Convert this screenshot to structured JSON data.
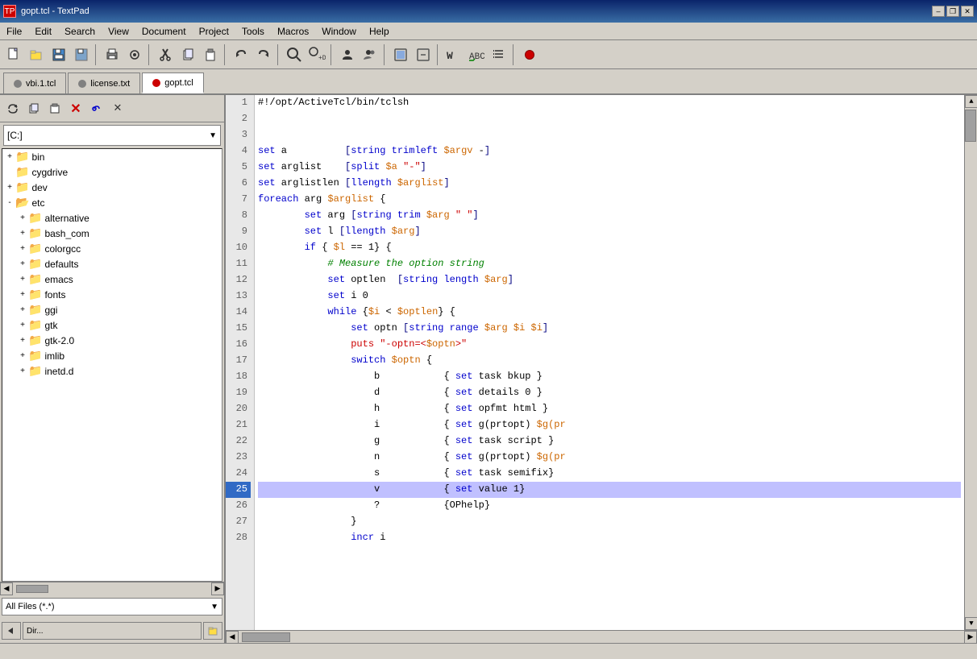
{
  "titlebar": {
    "title": "gopt.tcl - TextPad",
    "icon": "TP",
    "min": "–",
    "max": "❐",
    "close": "✕"
  },
  "menubar": {
    "items": [
      "File",
      "Edit",
      "Search",
      "View",
      "Document",
      "Project",
      "Tools",
      "Macros",
      "Window",
      "Help"
    ]
  },
  "tabs": [
    {
      "id": "vbi",
      "label": "vbi.1.tcl",
      "dot": "gray",
      "active": false
    },
    {
      "id": "license",
      "label": "license.txt",
      "dot": "gray",
      "active": false
    },
    {
      "id": "gopt",
      "label": "gopt.tcl",
      "dot": "red",
      "active": true
    }
  ],
  "sidebar": {
    "drive": "[C:]",
    "filter": "All Files (*.*)",
    "tree": [
      {
        "indent": 0,
        "toggle": "+",
        "name": "bin",
        "level": 1
      },
      {
        "indent": 0,
        "toggle": "",
        "name": "cygdrive",
        "level": 1
      },
      {
        "indent": 0,
        "toggle": "+",
        "name": "dev",
        "level": 1
      },
      {
        "indent": 0,
        "toggle": "-",
        "name": "etc",
        "level": 1
      },
      {
        "indent": 1,
        "toggle": "+",
        "name": "alternative",
        "level": 2
      },
      {
        "indent": 1,
        "toggle": "+",
        "name": "bash_com",
        "level": 2
      },
      {
        "indent": 1,
        "toggle": "+",
        "name": "colorgcc",
        "level": 2
      },
      {
        "indent": 1,
        "toggle": "+",
        "name": "defaults",
        "level": 2
      },
      {
        "indent": 1,
        "toggle": "+",
        "name": "emacs",
        "level": 2
      },
      {
        "indent": 1,
        "toggle": "+",
        "name": "fonts",
        "level": 2
      },
      {
        "indent": 1,
        "toggle": "+",
        "name": "ggi",
        "level": 2
      },
      {
        "indent": 1,
        "toggle": "+",
        "name": "gtk",
        "level": 2
      },
      {
        "indent": 1,
        "toggle": "+",
        "name": "gtk-2.0",
        "level": 2
      },
      {
        "indent": 1,
        "toggle": "+",
        "name": "imlib",
        "level": 2
      },
      {
        "indent": 1,
        "toggle": "+",
        "name": "inetd.d",
        "level": 2
      }
    ]
  },
  "code": {
    "shebang": "#!/opt/ActiveTcl/bin/tclsh",
    "lines": [
      {
        "num": 1,
        "tokens": [
          {
            "t": "plain",
            "v": "#!/opt/ActiveTcl/bin/tclsh"
          }
        ]
      },
      {
        "num": 2,
        "tokens": []
      },
      {
        "num": 3,
        "tokens": []
      },
      {
        "num": 4,
        "tokens": [
          {
            "t": "kw",
            "v": "set"
          },
          {
            "t": "plain",
            "v": " a          "
          },
          {
            "t": "bracket",
            "v": "["
          },
          {
            "t": "kw",
            "v": "string trimleft"
          },
          {
            "t": "plain",
            "v": " "
          },
          {
            "t": "var",
            "v": "$argv"
          },
          {
            "t": "plain",
            "v": " -"
          },
          {
            "t": "bracket",
            "v": "]"
          }
        ]
      },
      {
        "num": 5,
        "tokens": [
          {
            "t": "kw",
            "v": "set"
          },
          {
            "t": "plain",
            "v": " arglist    "
          },
          {
            "t": "bracket",
            "v": "["
          },
          {
            "t": "kw",
            "v": "split"
          },
          {
            "t": "plain",
            "v": " "
          },
          {
            "t": "var",
            "v": "$a"
          },
          {
            "t": "plain",
            "v": " "
          },
          {
            "t": "str",
            "v": "\"-\""
          },
          {
            "t": "bracket",
            "v": "]"
          }
        ]
      },
      {
        "num": 6,
        "tokens": [
          {
            "t": "kw",
            "v": "set"
          },
          {
            "t": "plain",
            "v": " arglistlen "
          },
          {
            "t": "bracket",
            "v": "["
          },
          {
            "t": "kw",
            "v": "llength"
          },
          {
            "t": "plain",
            "v": " "
          },
          {
            "t": "var",
            "v": "$arglist"
          },
          {
            "t": "bracket",
            "v": "]"
          }
        ]
      },
      {
        "num": 7,
        "tokens": [
          {
            "t": "kw",
            "v": "foreach"
          },
          {
            "t": "plain",
            "v": " arg "
          },
          {
            "t": "var",
            "v": "$arglist"
          },
          {
            "t": "plain",
            "v": " {"
          }
        ]
      },
      {
        "num": 8,
        "tokens": [
          {
            "t": "plain",
            "v": "        "
          },
          {
            "t": "kw",
            "v": "set"
          },
          {
            "t": "plain",
            "v": " arg "
          },
          {
            "t": "bracket",
            "v": "["
          },
          {
            "t": "kw",
            "v": "string trim"
          },
          {
            "t": "plain",
            "v": " "
          },
          {
            "t": "var",
            "v": "$arg"
          },
          {
            "t": "plain",
            "v": " "
          },
          {
            "t": "str",
            "v": "\" \""
          },
          {
            "t": "bracket",
            "v": "]"
          }
        ]
      },
      {
        "num": 9,
        "tokens": [
          {
            "t": "plain",
            "v": "        "
          },
          {
            "t": "kw",
            "v": "set"
          },
          {
            "t": "plain",
            "v": " l "
          },
          {
            "t": "bracket",
            "v": "["
          },
          {
            "t": "kw",
            "v": "llength"
          },
          {
            "t": "plain",
            "v": " "
          },
          {
            "t": "var",
            "v": "$arg"
          },
          {
            "t": "bracket",
            "v": "]"
          }
        ]
      },
      {
        "num": 10,
        "tokens": [
          {
            "t": "plain",
            "v": "        "
          },
          {
            "t": "kw",
            "v": "if"
          },
          {
            "t": "plain",
            "v": " { "
          },
          {
            "t": "var",
            "v": "$l"
          },
          {
            "t": "plain",
            "v": " == 1} {"
          }
        ]
      },
      {
        "num": 11,
        "tokens": [
          {
            "t": "plain",
            "v": "            "
          },
          {
            "t": "comment",
            "v": "# Measure the option string"
          }
        ]
      },
      {
        "num": 12,
        "tokens": [
          {
            "t": "plain",
            "v": "            "
          },
          {
            "t": "kw",
            "v": "set"
          },
          {
            "t": "plain",
            "v": " optlen  "
          },
          {
            "t": "bracket",
            "v": "["
          },
          {
            "t": "kw",
            "v": "string length"
          },
          {
            "t": "plain",
            "v": " "
          },
          {
            "t": "var",
            "v": "$arg"
          },
          {
            "t": "bracket",
            "v": "]"
          }
        ]
      },
      {
        "num": 13,
        "tokens": [
          {
            "t": "plain",
            "v": "            "
          },
          {
            "t": "kw",
            "v": "set"
          },
          {
            "t": "plain",
            "v": " i 0"
          }
        ]
      },
      {
        "num": 14,
        "tokens": [
          {
            "t": "plain",
            "v": "            "
          },
          {
            "t": "kw",
            "v": "while"
          },
          {
            "t": "plain",
            "v": " {"
          },
          {
            "t": "var",
            "v": "$i"
          },
          {
            "t": "plain",
            "v": " < "
          },
          {
            "t": "var",
            "v": "$optlen"
          },
          {
            "t": "plain",
            "v": "} {"
          }
        ]
      },
      {
        "num": 15,
        "tokens": [
          {
            "t": "plain",
            "v": "                "
          },
          {
            "t": "kw",
            "v": "set"
          },
          {
            "t": "plain",
            "v": " optn "
          },
          {
            "t": "bracket",
            "v": "["
          },
          {
            "t": "kw",
            "v": "string range"
          },
          {
            "t": "plain",
            "v": " "
          },
          {
            "t": "var",
            "v": "$arg"
          },
          {
            "t": "plain",
            "v": " "
          },
          {
            "t": "var",
            "v": "$i"
          },
          {
            "t": "plain",
            "v": " "
          },
          {
            "t": "var",
            "v": "$i"
          },
          {
            "t": "bracket",
            "v": "]"
          }
        ]
      },
      {
        "num": 16,
        "tokens": [
          {
            "t": "plain",
            "v": "                "
          },
          {
            "t": "str",
            "v": "puts"
          },
          {
            "t": "plain",
            "v": " "
          },
          {
            "t": "str",
            "v": "\"-optn=<"
          },
          {
            "t": "var",
            "v": "$optn"
          },
          {
            "t": "str",
            "v": ">\""
          }
        ]
      },
      {
        "num": 17,
        "tokens": [
          {
            "t": "plain",
            "v": "                "
          },
          {
            "t": "kw",
            "v": "switch"
          },
          {
            "t": "plain",
            "v": " "
          },
          {
            "t": "var",
            "v": "$optn"
          },
          {
            "t": "plain",
            "v": " {"
          }
        ]
      },
      {
        "num": 18,
        "tokens": [
          {
            "t": "plain",
            "v": "                    b           { "
          },
          {
            "t": "kw",
            "v": "set"
          },
          {
            "t": "plain",
            "v": " task bkup }"
          }
        ]
      },
      {
        "num": 19,
        "tokens": [
          {
            "t": "plain",
            "v": "                    d           { "
          },
          {
            "t": "kw",
            "v": "set"
          },
          {
            "t": "plain",
            "v": " details 0 }"
          }
        ]
      },
      {
        "num": 20,
        "tokens": [
          {
            "t": "plain",
            "v": "                    h           { "
          },
          {
            "t": "kw",
            "v": "set"
          },
          {
            "t": "plain",
            "v": " opfmt html }"
          }
        ]
      },
      {
        "num": 21,
        "tokens": [
          {
            "t": "plain",
            "v": "                    i           { "
          },
          {
            "t": "kw",
            "v": "set"
          },
          {
            "t": "plain",
            "v": " g(prtopt) "
          },
          {
            "t": "var",
            "v": "$g(pr"
          }
        ]
      },
      {
        "num": 22,
        "tokens": [
          {
            "t": "plain",
            "v": "                    g           { "
          },
          {
            "t": "kw",
            "v": "set"
          },
          {
            "t": "plain",
            "v": " task script }"
          }
        ]
      },
      {
        "num": 23,
        "tokens": [
          {
            "t": "plain",
            "v": "                    n           { "
          },
          {
            "t": "kw",
            "v": "set"
          },
          {
            "t": "plain",
            "v": " g(prtopt) "
          },
          {
            "t": "var",
            "v": "$g(pr"
          }
        ]
      },
      {
        "num": 24,
        "tokens": [
          {
            "t": "plain",
            "v": "                    s           { "
          },
          {
            "t": "kw",
            "v": "set"
          },
          {
            "t": "plain",
            "v": " task semifix}"
          }
        ]
      },
      {
        "num": 25,
        "tokens": [
          {
            "t": "plain",
            "v": "                    v           { "
          },
          {
            "t": "kw",
            "v": "set"
          },
          {
            "t": "plain",
            "v": " value 1}"
          }
        ],
        "selected": true
      },
      {
        "num": 26,
        "tokens": [
          {
            "t": "plain",
            "v": "                    ?           {OPhelp}"
          }
        ]
      },
      {
        "num": 27,
        "tokens": [
          {
            "t": "plain",
            "v": "                }"
          }
        ]
      },
      {
        "num": 28,
        "tokens": [
          {
            "t": "plain",
            "v": "                "
          },
          {
            "t": "kw",
            "v": "incr"
          },
          {
            "t": "plain",
            "v": " i"
          }
        ]
      }
    ]
  },
  "statusbar": {
    "text": ""
  },
  "icons": {
    "new": "📄",
    "open": "📂",
    "save": "💾",
    "print": "🖨",
    "cut": "✂",
    "copy": "📋",
    "paste": "📋",
    "undo": "↩",
    "redo": "↪",
    "find": "🔍",
    "folder_open": "📂",
    "folder_closed": "📁"
  }
}
